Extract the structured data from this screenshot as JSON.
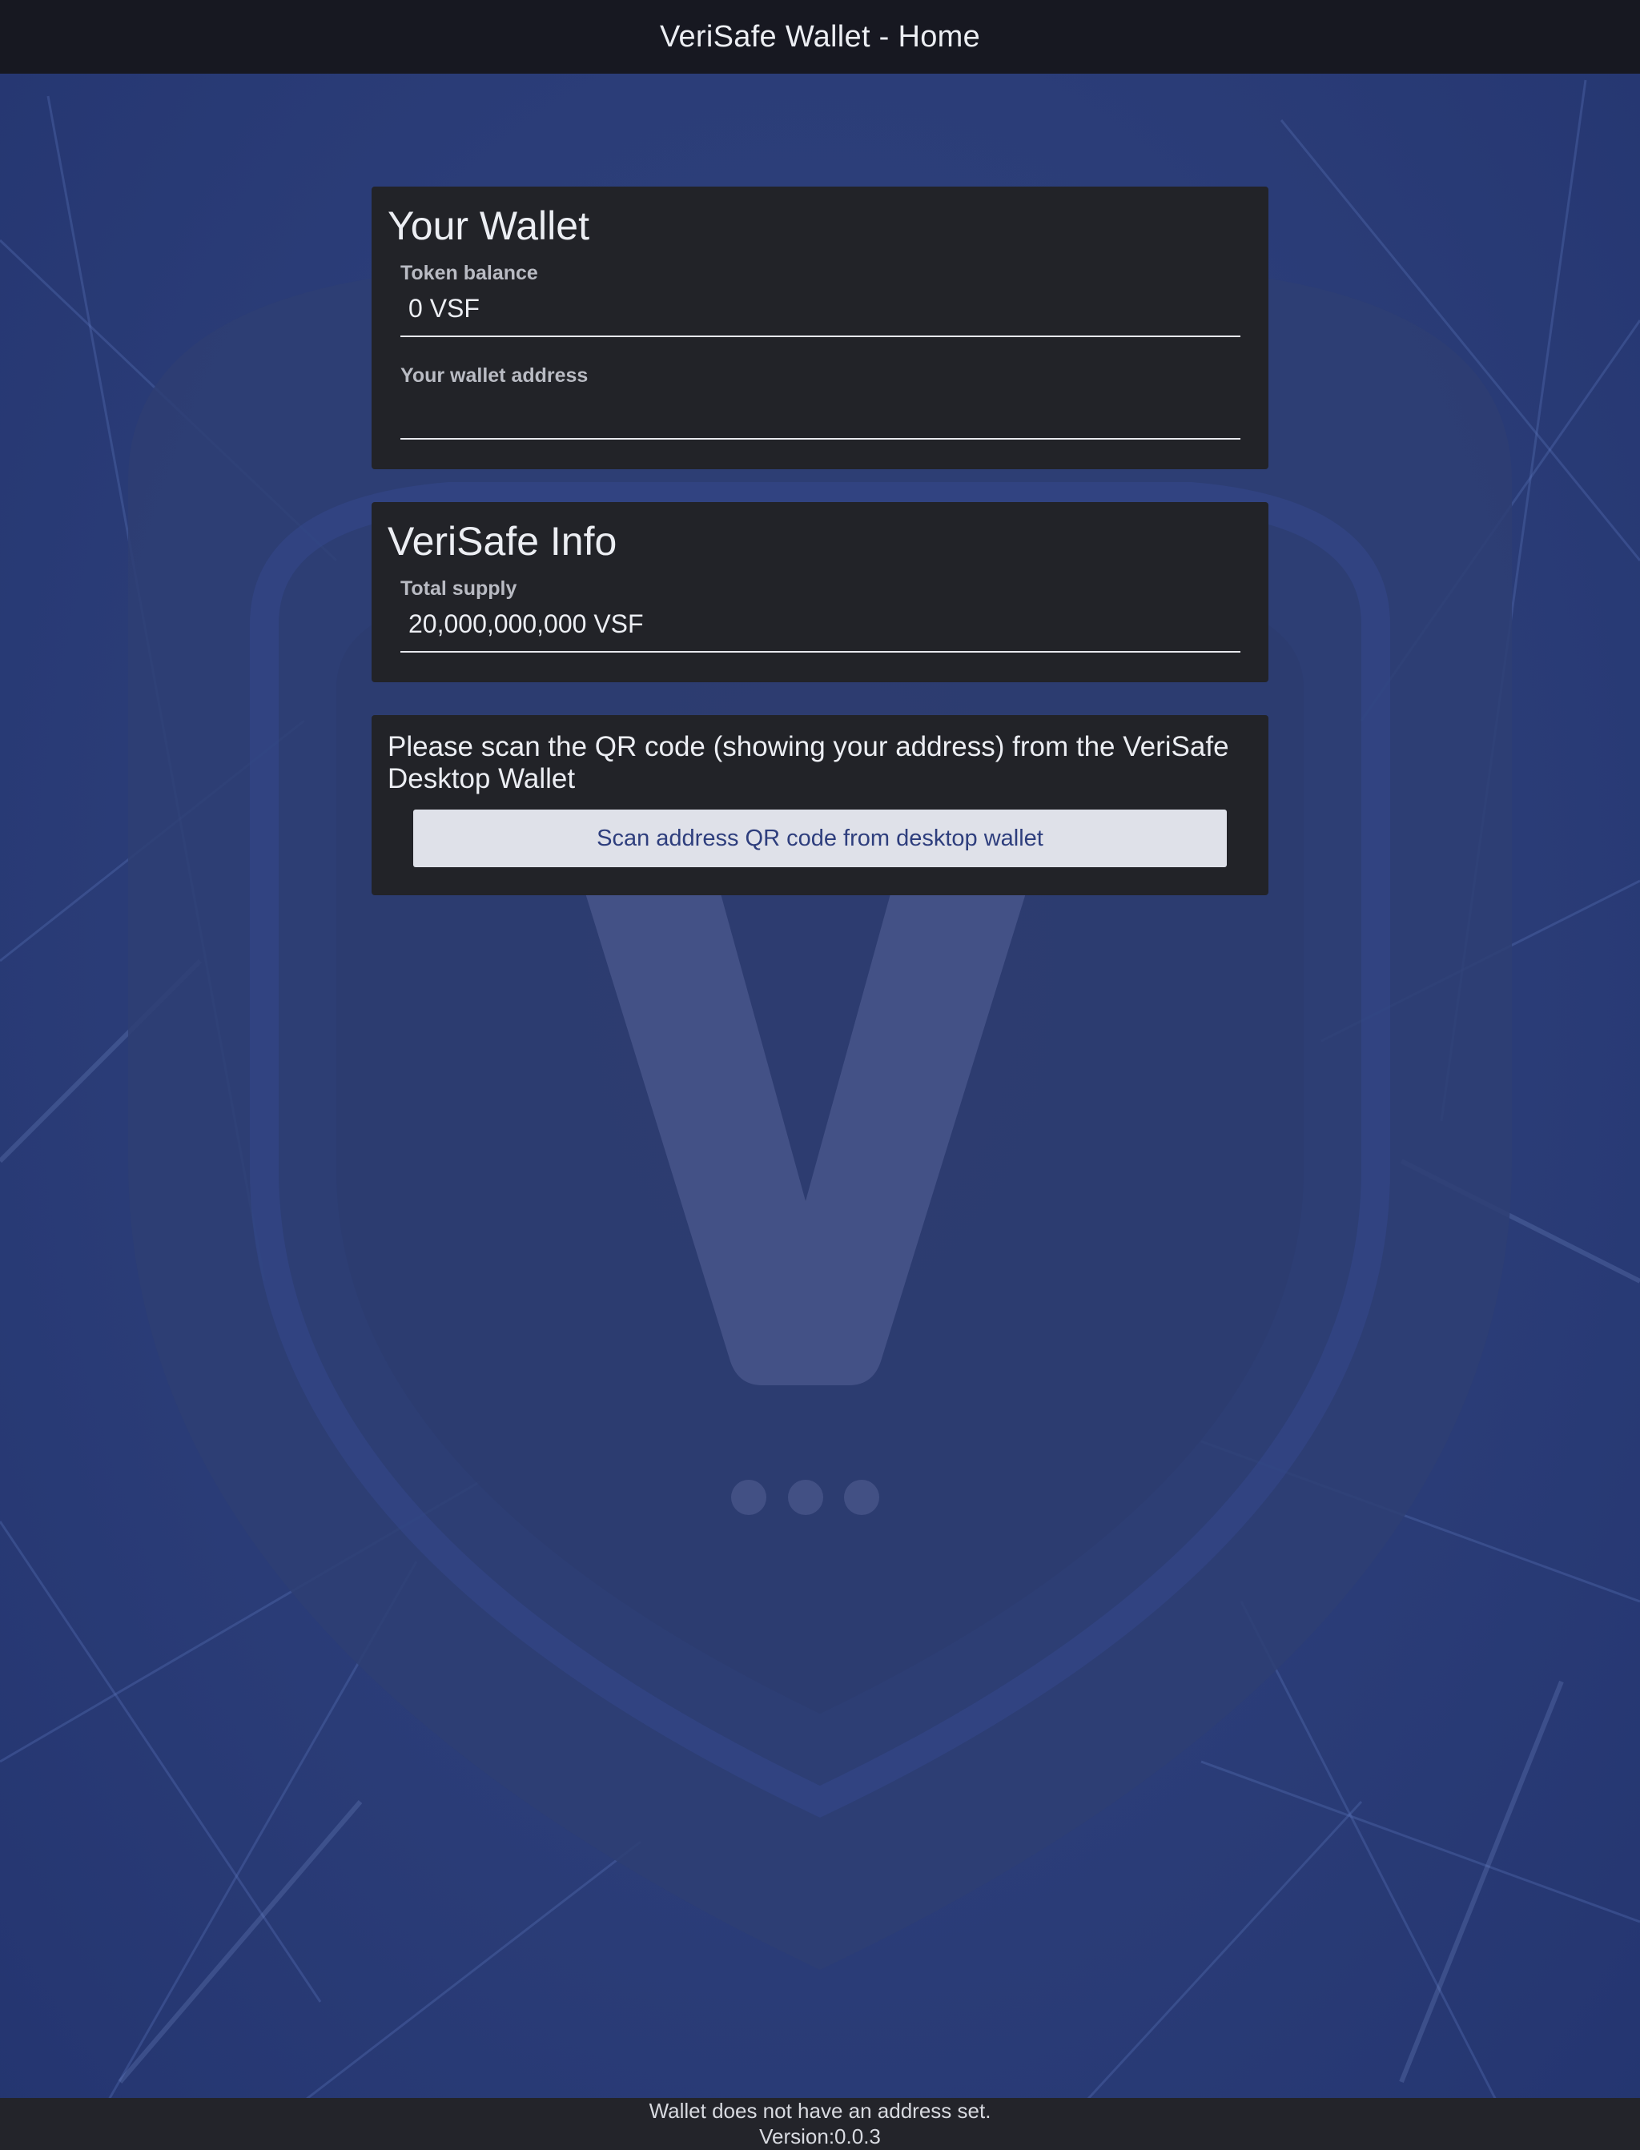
{
  "header": {
    "title": "VeriSafe Wallet - Home"
  },
  "wallet_card": {
    "title": "Your Wallet",
    "token_balance_label": "Token balance",
    "token_balance_value": "0 VSF",
    "wallet_address_label": "Your wallet address",
    "wallet_address_value": ""
  },
  "info_card": {
    "title": "VeriSafe Info",
    "total_supply_label": "Total supply",
    "total_supply_value": "20,000,000,000 VSF"
  },
  "scan_card": {
    "instruction": "Please scan the QR code (showing your address) from the VeriSafe Desktop Wallet",
    "button_label": "Scan address QR code from desktop wallet"
  },
  "footer": {
    "status": "Wallet does not have an address set.",
    "version": "Version:0.0.3"
  },
  "colors": {
    "header_bg": "#171821",
    "card_bg": "#222328",
    "background_blue": "#2b3d7a",
    "button_bg": "#dfe1e9",
    "button_text": "#2e3e7d"
  },
  "icons": {
    "background_logo": "verisafe-shield-logo"
  }
}
